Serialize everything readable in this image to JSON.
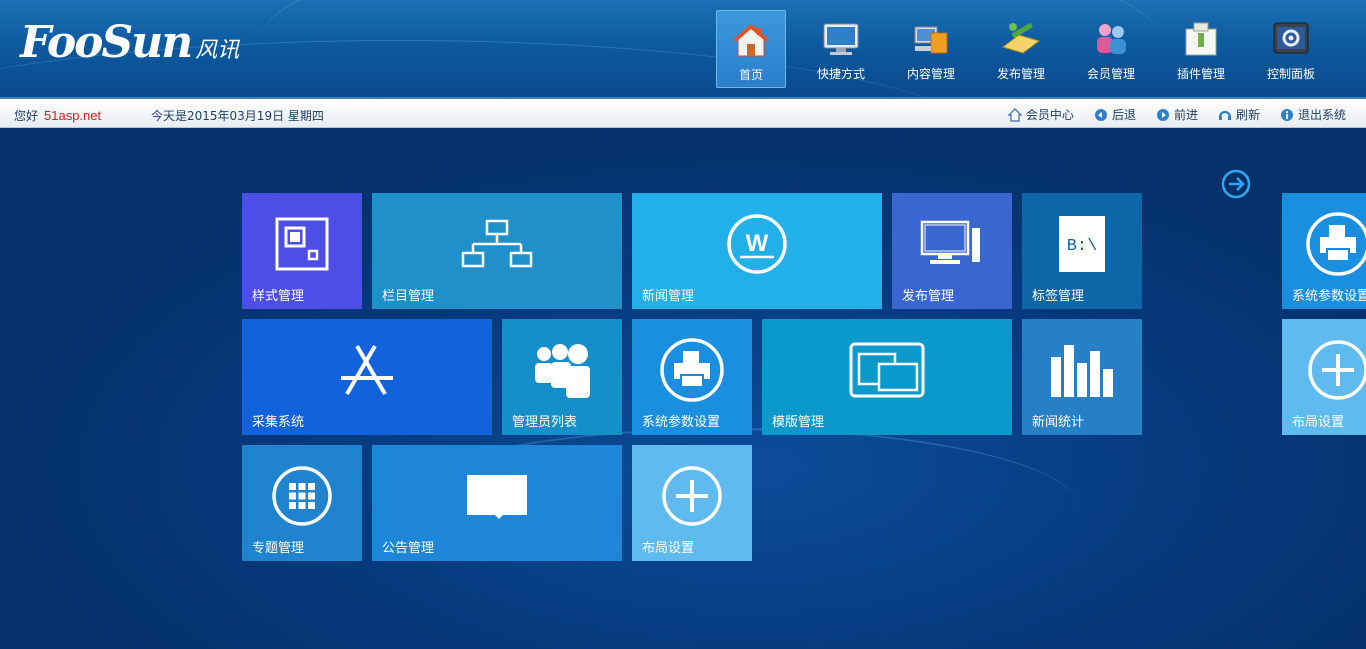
{
  "header": {
    "logo_text": "FooSun",
    "logo_cn": "风讯",
    "nav": [
      {
        "label": "首页",
        "active": true
      },
      {
        "label": "快捷方式"
      },
      {
        "label": "内容管理"
      },
      {
        "label": "发布管理"
      },
      {
        "label": "会员管理"
      },
      {
        "label": "插件管理"
      },
      {
        "label": "控制面板"
      }
    ]
  },
  "toolbar": {
    "hello": "您好",
    "username": "51asp.net",
    "date": "今天是2015年03月19日 星期四",
    "links": [
      "会员中心",
      "后退",
      "前进",
      "刷新",
      "退出系统"
    ]
  },
  "tiles": [
    {
      "label": "样式管理",
      "color": "#4d4de8"
    },
    {
      "label": "栏目管理",
      "color": "#1f90c9"
    },
    {
      "label": "新闻管理",
      "color": "#22b0e8"
    },
    {
      "label": "发布管理",
      "color": "#3a66cf"
    },
    {
      "label": "标签管理",
      "color": "#0e66a8"
    },
    {
      "label": "采集系统",
      "color": "#1262db"
    },
    {
      "label": "管理员列表",
      "color": "#158fc9"
    },
    {
      "label": "系统参数设置",
      "color": "#1a8fe0"
    },
    {
      "label": "模版管理",
      "color": "#0b99cc"
    },
    {
      "label": "新闻统计",
      "color": "#2780c6"
    },
    {
      "label": "专题管理",
      "color": "#1f83cf"
    },
    {
      "label": "公告管理",
      "color": "#1e86d8"
    },
    {
      "label": "布局设置",
      "color": "#5ebaef"
    },
    {
      "label": "系统参数设置",
      "color": "#1a8fe0"
    },
    {
      "label": "布局设置",
      "color": "#5ebaef"
    }
  ]
}
